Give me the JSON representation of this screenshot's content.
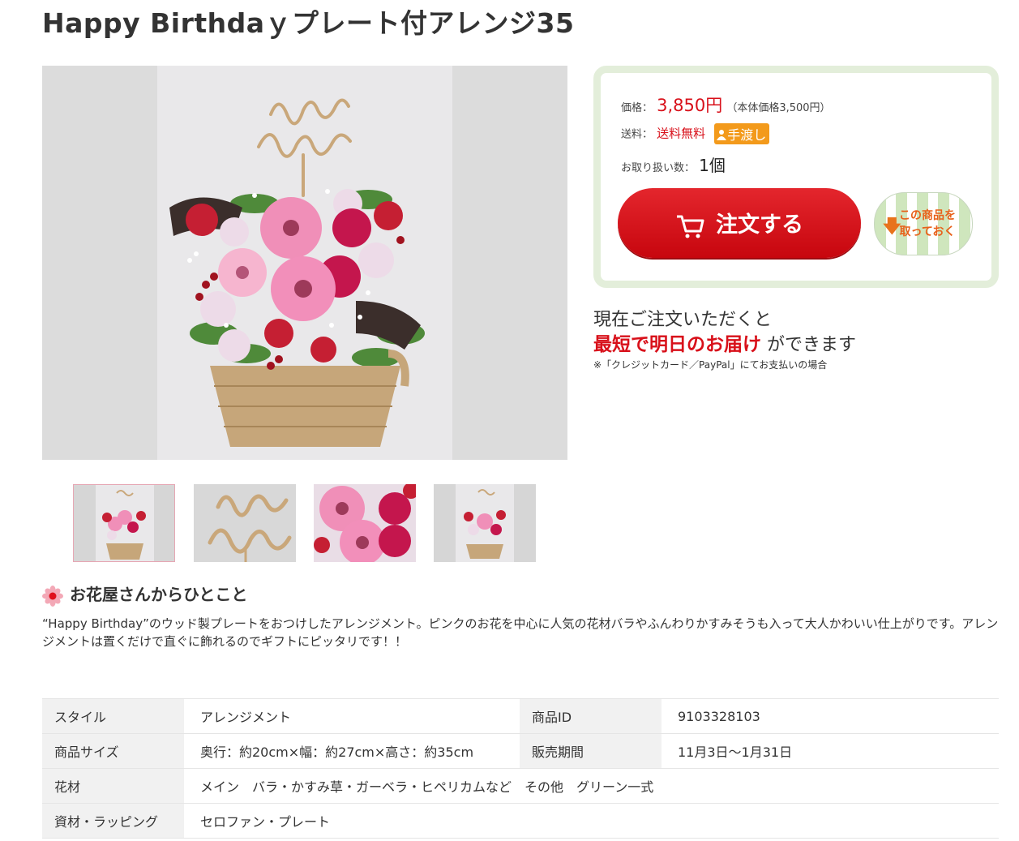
{
  "product": {
    "title": "Happy Birthdaｙプレート付アレンジ35",
    "price_label": "価格：",
    "price": "3,850円",
    "price_note": "（本体価格3,500円）",
    "shipping_label": "送料：",
    "shipping_value": "送料無料",
    "handover_badge": "手渡し",
    "qty_label": "お取り扱い数：",
    "qty_value": "1個",
    "order_button": "注文する",
    "keep_button_line1": "この商品を",
    "keep_button_line2": "取っておく"
  },
  "delivery": {
    "line1": "現在ご注文いただくと",
    "highlight": "最短で明日のお届け",
    "line2_rest": " ができます",
    "note": "※「クレジットカード／PayPal」にてお支払いの場合"
  },
  "florist_comment": {
    "heading": "お花屋さんからひとこと",
    "body": "“Happy Birthday”のウッド製プレートをおつけしたアレンジメント。ピンクのお花を中心に人気の花材バラやふんわりかすみそうも入って大人かわいい仕上がりです。アレンジメントは置くだけで直ぐに飾れるのでギフトにピッタリです！！"
  },
  "specs": {
    "style_label": "スタイル",
    "style_value": "アレンジメント",
    "id_label": "商品ID",
    "id_value": "9103328103",
    "size_label": "商品サイズ",
    "size_value": "奥行：約20cm×幅：約27cm×高さ：約35cm",
    "period_label": "販売期間",
    "period_value": "11月3日〜1月31日",
    "flowers_label": "花材",
    "flowers_value": "メイン　バラ・かすみ草・ガーベラ・ヒペリカムなど　その他　グリーン一式",
    "wrapping_label": "資材・ラッピング",
    "wrapping_value": "セロファン・プレート"
  },
  "colors": {
    "accent_red": "#d8101a",
    "panel_border": "#e3eeda",
    "badge_orange": "#f39a1b"
  },
  "icons": [
    "cart-icon",
    "down-arrow-icon",
    "flower-icon",
    "person-icon"
  ]
}
